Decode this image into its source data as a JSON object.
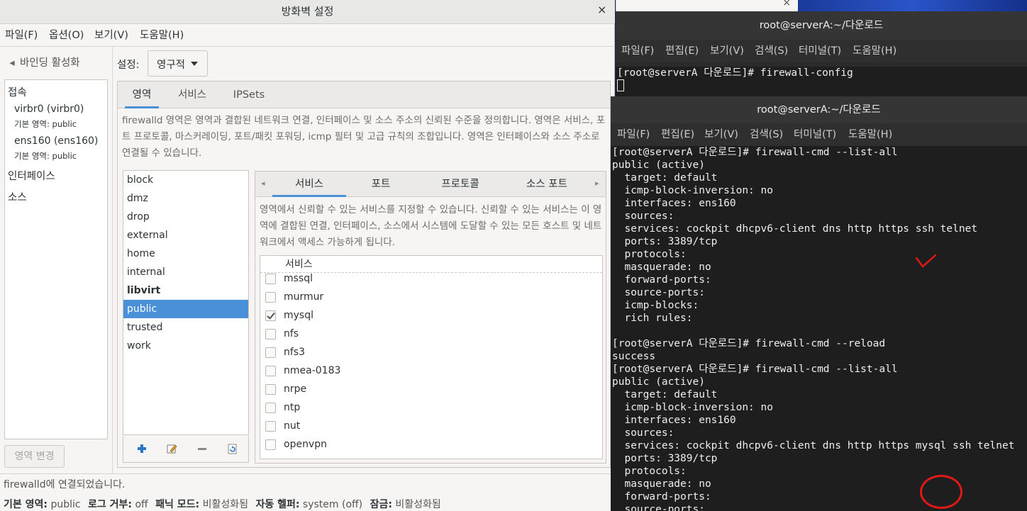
{
  "firewall": {
    "title": "방화벽 설정",
    "close_glyph": "×",
    "menu": [
      "파일(F)",
      "옵션(O)",
      "보기(V)",
      "도움말(H)"
    ],
    "binding_toggle": "바인딩 활성화",
    "sidebar": {
      "connections_head": "접속",
      "interfaces": [
        {
          "name": "virbr0 (virbr0)",
          "zone_label": "기본 영역:",
          "zone": "public"
        },
        {
          "name": "ens160 (ens160)",
          "zone_label": "기본 영역:",
          "zone": "public"
        }
      ],
      "interfaces_head": "인터페이스",
      "sources_head": "소스"
    },
    "zone_change_button": "영역 변경",
    "setting_label": "설정:",
    "setting_value": "영구적",
    "main_tabs": [
      "영역",
      "서비스",
      "IPSets"
    ],
    "zone_description": "firewalld 영역은 영역과 결합된 네트워크 연결, 인터페이스 및 소스 주소의 신뢰된 수준을 정의합니다. 영역은 서비스, 포트 프로토콜, 마스커레이딩, 포트/패킷 포워딩, icmp 필터 및 고급 규칙의 조합입니다. 영역은 인터페이스와 소스 주소로 연결될 수 있습니다.",
    "zones": [
      "block",
      "dmz",
      "drop",
      "external",
      "home",
      "internal",
      "libvirt",
      "public",
      "trusted",
      "work"
    ],
    "selected_zone": "public",
    "sub_tabs": [
      "서비스",
      "포트",
      "프로토콜",
      "소스 포트"
    ],
    "service_description": "영역에서 신뢰할 수 있는 서비스를 지정할 수 있습니다. 신뢰할 수 있는 서비스는 이 영역에 결합된 연결, 인터페이스, 소스에서 시스템에 도달할 수 있는 모든 호스트 및 네트워크에서 액세스 가능하게 됩니다.",
    "service_column_header": "서비스",
    "services": [
      {
        "name": "mssql",
        "checked": false
      },
      {
        "name": "murmur",
        "checked": false
      },
      {
        "name": "mysql",
        "checked": true
      },
      {
        "name": "nfs",
        "checked": false
      },
      {
        "name": "nfs3",
        "checked": false
      },
      {
        "name": "nmea-0183",
        "checked": false
      },
      {
        "name": "nrpe",
        "checked": false
      },
      {
        "name": "ntp",
        "checked": false
      },
      {
        "name": "nut",
        "checked": false
      },
      {
        "name": "openvpn",
        "checked": false
      }
    ],
    "status_message": "firewalld에 연결되었습니다.",
    "bottom": {
      "default_zone_label": "기본 영역:",
      "default_zone": "public",
      "log_denied_label": "로그 거부:",
      "log_denied": "off",
      "panic_label": "패닉 모드:",
      "panic": "비활성화됨",
      "helper_label": "자동 헬퍼:",
      "helper": "system (off)",
      "lockdown_label": "잠금:",
      "lockdown": "비활성화됨"
    }
  },
  "terminal_back": {
    "title": "root@serverA:~/다운로드",
    "menu": [
      "파일(F)",
      "편집(E)",
      "보기(V)",
      "검색(S)",
      "터미널(T)",
      "도움말(H)"
    ],
    "lines": [
      "[root@serverA 다운로드]# firewall-config"
    ]
  },
  "terminal_front": {
    "title": "root@serverA:~/다운로드",
    "menu": [
      "파일(F)",
      "편집(E)",
      "보기(V)",
      "검색(S)",
      "터미널(T)",
      "도움말(H)"
    ],
    "lines": [
      "[root@serverA 다운로드]# firewall-cmd --list-all",
      "public (active)",
      "  target: default",
      "  icmp-block-inversion: no",
      "  interfaces: ens160",
      "  sources:",
      "  services: cockpit dhcpv6-client dns http https ssh telnet",
      "  ports: 3389/tcp",
      "  protocols:",
      "  masquerade: no",
      "  forward-ports:",
      "  source-ports:",
      "  icmp-blocks:",
      "  rich rules:",
      "",
      "[root@serverA 다운로드]# firewall-cmd --reload",
      "success",
      "[root@serverA 다운로드]# firewall-cmd --list-all",
      "public (active)",
      "  target: default",
      "  icmp-block-inversion: no",
      "  interfaces: ens160",
      "  sources:",
      "  services: cockpit dhcpv6-client dns http https mysql ssh telnet",
      "  ports: 3389/tcp",
      "  protocols:",
      "  masquerade: no",
      "  forward-ports:",
      "  source-ports:"
    ]
  },
  "colors": {
    "accent": "#4a90d9",
    "annotation_red": "#e01818",
    "terminal_bg": "#1e1e1e"
  }
}
